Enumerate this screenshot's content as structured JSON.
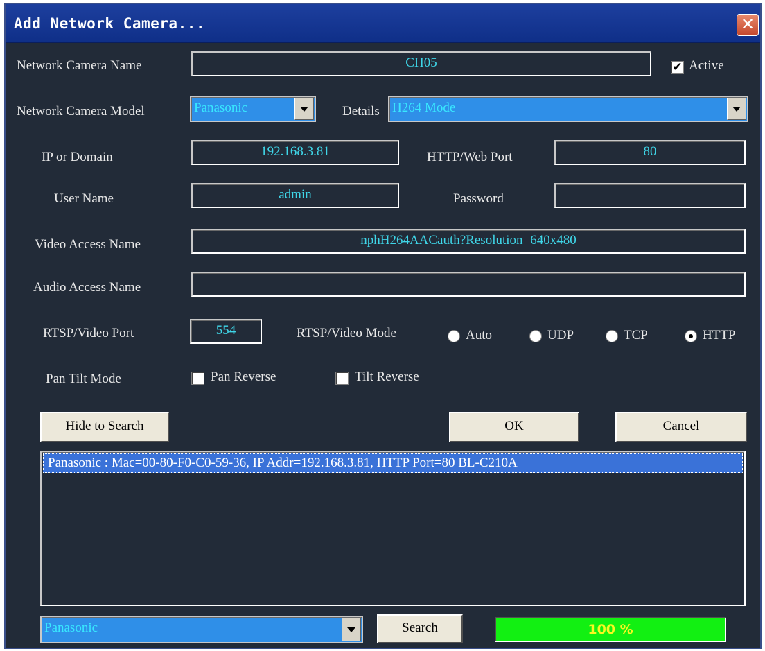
{
  "window": {
    "title": "Add Network Camera...",
    "close_glyph": "✕"
  },
  "camera_name": {
    "label": "Network Camera Name",
    "value": "CH05"
  },
  "active": {
    "label": "Active",
    "checked": true,
    "check_glyph": "✔"
  },
  "model": {
    "label": "Network Camera Model",
    "value": "Panasonic"
  },
  "details": {
    "label": "Details",
    "value": "H264 Mode"
  },
  "ip": {
    "label": "IP or Domain",
    "value": "192.168.3.81"
  },
  "http_port": {
    "label": "HTTP/Web Port",
    "value": "80"
  },
  "user": {
    "label": "User Name",
    "value": "admin"
  },
  "password": {
    "label": "Password",
    "value": ""
  },
  "video_access": {
    "label": "Video Access Name",
    "value": "nphH264AACauth?Resolution=640x480"
  },
  "audio_access": {
    "label": "Audio Access Name",
    "value": ""
  },
  "rtsp_port": {
    "label": "RTSP/Video Port",
    "value": "554"
  },
  "rtsp_mode": {
    "label": "RTSP/Video Mode",
    "options": [
      "Auto",
      "UDP",
      "TCP",
      "HTTP"
    ],
    "selected": "HTTP"
  },
  "pan_tilt": {
    "label": "Pan Tilt Mode",
    "pan_reverse": "Pan Reverse",
    "tilt_reverse": "Tilt Reverse"
  },
  "buttons": {
    "hide_to_search": "Hide to Search",
    "ok": "OK",
    "cancel": "Cancel",
    "search": "Search"
  },
  "search_results": [
    "Panasonic : Mac=00-80-F0-C0-59-36,  IP Addr=192.168.3.81,  HTTP Port=80  BL-C210A"
  ],
  "search_vendor": "Panasonic",
  "progress": {
    "text": "100 %",
    "percent": 100
  },
  "colors": {
    "background": "#222b38",
    "field_text": "#3fd6e8",
    "combo_bg": "#2f8fe8",
    "progress_bg": "#12f012",
    "progress_text": "#f8f820",
    "selection": "#3a72d8"
  },
  "icons": {
    "dropdown": "chevron-down-icon",
    "close": "close-icon",
    "check": "checkmark-icon"
  }
}
